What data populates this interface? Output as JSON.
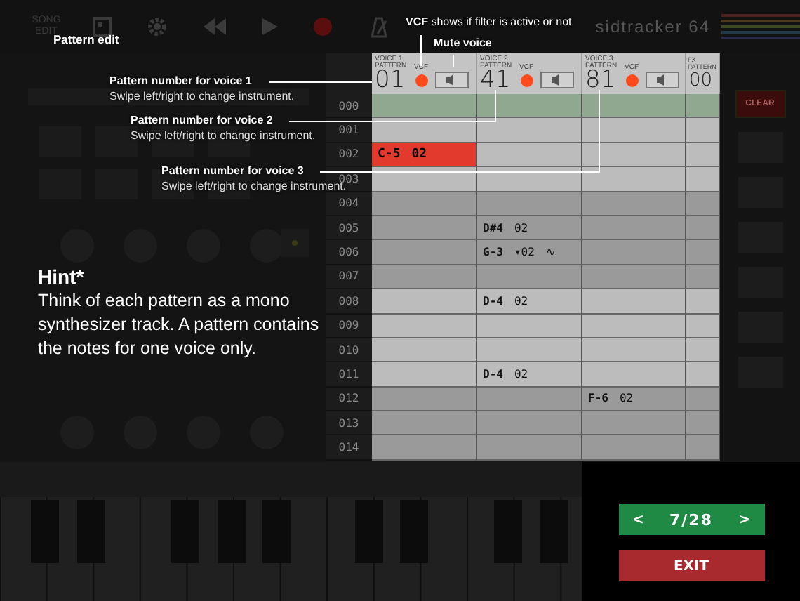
{
  "toolbar": {
    "song_edit": "SONG EDIT",
    "app_title": "sidtracker 64"
  },
  "tracker": {
    "voices": [
      {
        "label": "VOICE 1",
        "sublabel": "PATTERN",
        "number": "01",
        "vcf_label": "VCF",
        "vcf_active": true,
        "muted": false
      },
      {
        "label": "VOICE 2",
        "sublabel": "PATTERN",
        "number": "41",
        "vcf_label": "VCF",
        "vcf_active": true,
        "muted": false
      },
      {
        "label": "VOICE 3",
        "sublabel": "PATTERN",
        "number": "81",
        "vcf_label": "VCF",
        "vcf_active": true,
        "muted": false
      }
    ],
    "fx": {
      "label": "FX",
      "sublabel": "PATTERN",
      "number": "00"
    },
    "rows": [
      {
        "number": "000",
        "playing": true,
        "cells": [
          {
            "selected": false
          },
          {
            "selected": false
          },
          {
            "selected": false
          }
        ]
      },
      {
        "number": "001",
        "playing": false,
        "cells": [
          {
            "selected": false
          },
          {
            "selected": false
          },
          {
            "selected": false
          }
        ]
      },
      {
        "number": "002",
        "playing": false,
        "cells": [
          {
            "note": "C-5",
            "instrument": "02",
            "selected": true
          },
          {
            "selected": false
          },
          {
            "selected": false
          }
        ]
      },
      {
        "number": "003",
        "playing": false,
        "cells": [
          {
            "selected": false
          },
          {
            "selected": false
          },
          {
            "selected": false
          }
        ]
      },
      {
        "number": "004",
        "playing": false,
        "cells": [
          {
            "selected": false
          },
          {
            "selected": false
          },
          {
            "selected": false
          }
        ]
      },
      {
        "number": "005",
        "playing": false,
        "cells": [
          {
            "selected": false
          },
          {
            "note": "D#4",
            "instrument": "02",
            "selected": false
          },
          {
            "selected": false
          }
        ]
      },
      {
        "number": "006",
        "playing": false,
        "cells": [
          {
            "selected": false
          },
          {
            "note": "G-3",
            "instrument": "▾02",
            "effect": "∿",
            "selected": false
          },
          {
            "selected": false
          }
        ]
      },
      {
        "number": "007",
        "playing": false,
        "cells": [
          {
            "selected": false
          },
          {
            "selected": false
          },
          {
            "selected": false
          }
        ]
      },
      {
        "number": "008",
        "playing": false,
        "cells": [
          {
            "selected": false
          },
          {
            "note": "D-4",
            "instrument": "02",
            "selected": false
          },
          {
            "selected": false
          }
        ]
      },
      {
        "number": "009",
        "playing": false,
        "cells": [
          {
            "selected": false
          },
          {
            "selected": false
          },
          {
            "selected": false
          }
        ]
      },
      {
        "number": "010",
        "playing": false,
        "cells": [
          {
            "selected": false
          },
          {
            "selected": false
          },
          {
            "selected": false
          }
        ]
      },
      {
        "number": "011",
        "playing": false,
        "cells": [
          {
            "selected": false
          },
          {
            "note": "D-4",
            "instrument": "02",
            "selected": false
          },
          {
            "selected": false
          }
        ]
      },
      {
        "number": "012",
        "playing": false,
        "cells": [
          {
            "selected": false
          },
          {
            "selected": false
          },
          {
            "note": "F-6",
            "instrument": "02",
            "selected": false
          }
        ]
      },
      {
        "number": "013",
        "playing": false,
        "cells": [
          {
            "selected": false
          },
          {
            "selected": false
          },
          {
            "selected": false
          }
        ]
      },
      {
        "number": "014",
        "playing": false,
        "cells": [
          {
            "selected": false
          },
          {
            "selected": false
          },
          {
            "selected": false
          }
        ]
      }
    ]
  },
  "right_panel": {
    "clear_button": "CLEAR"
  },
  "tutorial": {
    "section": "Pattern edit",
    "callouts": [
      {
        "title": "**VCF** shows if filter is active or not"
      },
      {
        "title": "Mute voice"
      },
      {
        "title": "Pattern number for voice 1",
        "description": "Swipe left/right to change instrument."
      },
      {
        "title": "Pattern number for voice 2",
        "description": "Swipe left/right to change instrument."
      },
      {
        "title": "Pattern number for voice 3",
        "description": "Swipe left/right to change instrument."
      }
    ],
    "hint": {
      "title": "Hint*",
      "text": "Think of each pattern as a mono synthesizer track. A pattern contains the notes for one voice only."
    }
  },
  "navigation": {
    "prev": "<",
    "page": "7/28",
    "next": ">",
    "exit": "EXIT"
  }
}
